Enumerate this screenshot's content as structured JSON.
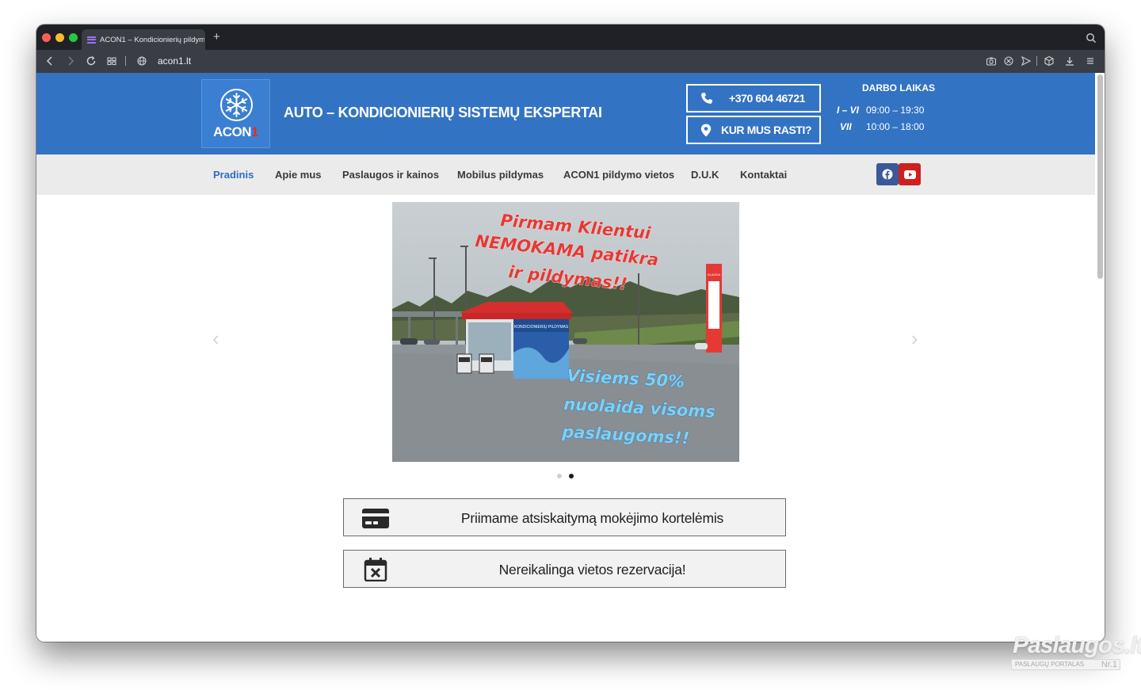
{
  "browser": {
    "tab_title": "ACON1 – Kondicionierių pildym",
    "new_tab": "+",
    "url": "acon1.lt"
  },
  "header": {
    "logo_text": "ACON",
    "logo_accent": "1",
    "tagline": "AUTO – KONDICIONIERIŲ SISTEMŲ EKSPERTAI",
    "phone": "+370 604 46721",
    "location_button": "KUR MUS RASTI?",
    "hours_title": "DARBO LAIKAS",
    "hours": [
      {
        "days": "I – VI",
        "time": "09:00 – 19:30"
      },
      {
        "days": "VII",
        "time": "10:00 – 18:00"
      }
    ]
  },
  "nav": {
    "items": [
      "Pradinis",
      "Apie mus",
      "Paslaugos ir kainos",
      "Mobilus pildymas",
      "ACON1 pildymo vietos",
      "D.U.K",
      "Kontaktai"
    ],
    "active": "Pradinis"
  },
  "slider": {
    "promo_top": [
      "Pirmam Klientui",
      "NEMOKAMA patikra",
      "ir pildymas!!"
    ],
    "promo_bottom": [
      "Visiems 50%",
      "nuolaida visoms",
      "paslaugoms!!"
    ],
    "kiosk_sign": "KONDICIONIERIŲ PILDYMAS",
    "station_sign": "ALAUDA",
    "slide_count": 2,
    "active_slide": 2
  },
  "features": [
    {
      "icon": "credit-card-icon",
      "text": "Priimame atsiskaitymą mokėjimo kortelėmis"
    },
    {
      "icon": "calendar-x-icon",
      "text": "Nereikalinga vietos rezervacija!"
    }
  ],
  "watermark": {
    "brand": "Paslaugos.lt",
    "subtitle": "PASLAUGŲ PORTALAS",
    "badge": "Nr.1"
  },
  "colors": {
    "header_blue": "#3373c4",
    "nav_bg": "#ebebeb",
    "active_nav": "#2f6cc2",
    "promo_red": "#e53935",
    "promo_blue": "#7fd0f5",
    "facebook": "#3b5998",
    "youtube": "#cd201f"
  }
}
